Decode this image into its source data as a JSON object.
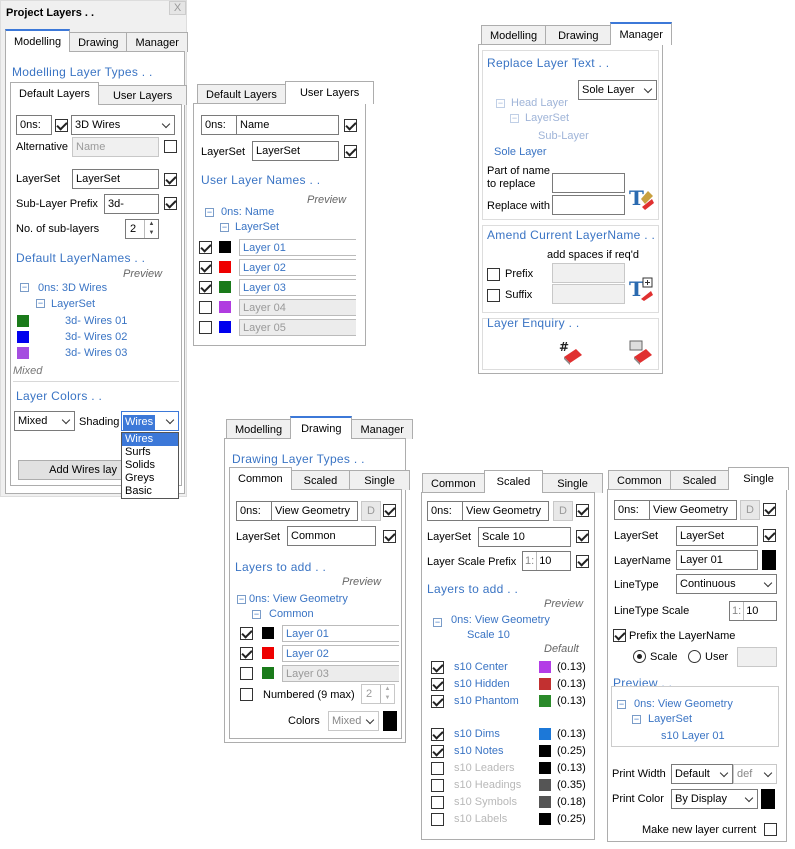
{
  "p1": {
    "title": "Project Layers . .",
    "close": "X",
    "tabs": [
      "Modelling",
      "Drawing",
      "Manager"
    ],
    "section": "Modelling Layer Types . .",
    "subtabs": [
      "Default Layers",
      "User Layers"
    ],
    "ons": "0ns:",
    "ons_value": "3D Wires",
    "alternative": "Alternative",
    "alt_placeholder": "Name",
    "layerset_label": "LayerSet",
    "layerset_value": "LayerSet",
    "prefix_label": "Sub-Layer Prefix",
    "prefix_value": "3d-",
    "nsub_label": "No. of sub-layers",
    "nsub_value": "2",
    "names_header": "Default LayerNames . .",
    "preview": "Preview",
    "tree_root": "0ns: 3D Wires",
    "tree_set": "LayerSet",
    "tree_items": [
      {
        "name": "3d- Wires  01",
        "color": "#1a7a1a"
      },
      {
        "name": "3d- Wires  02",
        "color": "#0000ee"
      },
      {
        "name": "3d- Wires  03",
        "color": "#a54ee0"
      }
    ],
    "mixed": "Mixed",
    "colors_header": "Layer Colors . .",
    "color_mode": "Mixed",
    "shading_label": "Shading",
    "shading_value": "Wires",
    "shading_options": [
      "Wires",
      "Surfs",
      "Solids",
      "Greys",
      "Basic"
    ],
    "add_button": "Add Wires lay"
  },
  "p2": {
    "tabs": [
      "Default Layers",
      "User Layers"
    ],
    "ons": "0ns:",
    "name_value": "Name",
    "layerset_label": "LayerSet",
    "layerset_value": "LayerSet",
    "names_header": "User Layer Names . .",
    "preview": "Preview",
    "tree_root": "0ns: Name",
    "tree_set": "LayerSet",
    "layers": [
      {
        "name": "Layer 01",
        "color": "#000000",
        "checked": true
      },
      {
        "name": "Layer 02",
        "color": "#ee0000",
        "checked": true
      },
      {
        "name": "Layer 03",
        "color": "#1a7a1a",
        "checked": true
      },
      {
        "name": "Layer 04",
        "color": "#b03ce0",
        "checked": false
      },
      {
        "name": "Layer 05",
        "color": "#0000ee",
        "checked": false
      }
    ]
  },
  "p3": {
    "tabs": [
      "Modelling",
      "Drawing",
      "Manager"
    ],
    "replace_header": "Replace Layer Text . .",
    "scope_value": "Sole Layer",
    "tree": [
      "Head Layer",
      "LayerSet",
      "Sub-Layer",
      "Sole Layer"
    ],
    "part_label_1": "Part of name",
    "part_label_2": "to replace",
    "replace_with": "Replace with",
    "amend_header": "Amend Current LayerName . .",
    "add_spaces": "add spaces if req'd",
    "prefix": "Prefix",
    "suffix": "Suffix",
    "enquiry_header": "Layer Enquiry . ."
  },
  "p4": {
    "tabs": [
      "Modelling",
      "Drawing",
      "Manager"
    ],
    "section": "Drawing Layer Types . .",
    "subtabs": [
      "Common",
      "Scaled",
      "Single"
    ],
    "ons": "0ns:",
    "ons_value": "View Geometry",
    "d": "D",
    "layerset_label": "LayerSet",
    "layerset_value": "Common",
    "add_header": "Layers to add . .",
    "preview": "Preview",
    "tree_root": "0ns: View Geometry",
    "tree_set": "Common",
    "layers": [
      {
        "name": "Layer 01",
        "color": "#000000",
        "checked": true
      },
      {
        "name": "Layer 02",
        "color": "#ee0000",
        "checked": true
      },
      {
        "name": "Layer 03",
        "color": "#1a7a1a",
        "checked": false
      }
    ],
    "numbered": "Numbered (9 max)",
    "numbered_value": "2",
    "colors_label": "Colors",
    "colors_value": "Mixed"
  },
  "p5": {
    "tabs": [
      "Common",
      "Scaled",
      "Single"
    ],
    "ons": "0ns:",
    "ons_value": "View Geometry",
    "d": "D",
    "layerset_label": "LayerSet",
    "layerset_value": "Scale 10",
    "prefix_label": "Layer Scale Prefix",
    "prefix_num": "1:",
    "prefix_value": "10",
    "add_header": "Layers to add . .",
    "preview": "Preview",
    "tree_root": "0ns: View Geometry",
    "tree_set": "Scale 10",
    "default": "Default",
    "layers": [
      {
        "name": "s10 Center",
        "color": "#b33ce6",
        "val": "(0.13)",
        "checked": true
      },
      {
        "name": "s10 Hidden",
        "color": "#c23030",
        "val": "(0.13)",
        "checked": true
      },
      {
        "name": "s10 Phantom",
        "color": "#2a8a2a",
        "val": "(0.13)",
        "checked": true
      },
      {
        "name": "s10 Dims",
        "color": "#1c78d8",
        "val": "(0.13)",
        "checked": true
      },
      {
        "name": "s10 Notes",
        "color": "#000000",
        "val": "(0.25)",
        "checked": true
      },
      {
        "name": "s10 Leaders",
        "color": "#000000",
        "val": "(0.13)",
        "checked": false
      },
      {
        "name": "s10 Headings",
        "color": "#555555",
        "val": "(0.35)",
        "checked": false
      },
      {
        "name": "s10 Symbols",
        "color": "#555555",
        "val": "(0.18)",
        "checked": false
      },
      {
        "name": "s10 Labels",
        "color": "#000000",
        "val": "(0.25)",
        "checked": false
      }
    ]
  },
  "p6": {
    "tabs": [
      "Common",
      "Scaled",
      "Single"
    ],
    "ons": "0ns:",
    "ons_value": "View Geometry",
    "d": "D",
    "layerset_label": "LayerSet",
    "layerset_value": "LayerSet",
    "layername_label": "LayerName",
    "layername_value": "Layer 01",
    "linetype_label": "LineType",
    "linetype_value": "Continuous",
    "ltscale_label": "LineType Scale",
    "ltscale_num": "1:",
    "ltscale_value": "10",
    "prefix_label": "Prefix the LayerName",
    "scale": "Scale",
    "user": "User",
    "preview": "Preview . .",
    "tree_root": "0ns: View Geometry",
    "tree_set": "LayerSet",
    "tree_leaf": "s10 Layer 01",
    "print_width_label": "Print Width",
    "print_width_value": "Default",
    "def_value": "def",
    "print_color_label": "Print Color",
    "print_color_value": "By Display",
    "make_current": "Make new layer current"
  }
}
